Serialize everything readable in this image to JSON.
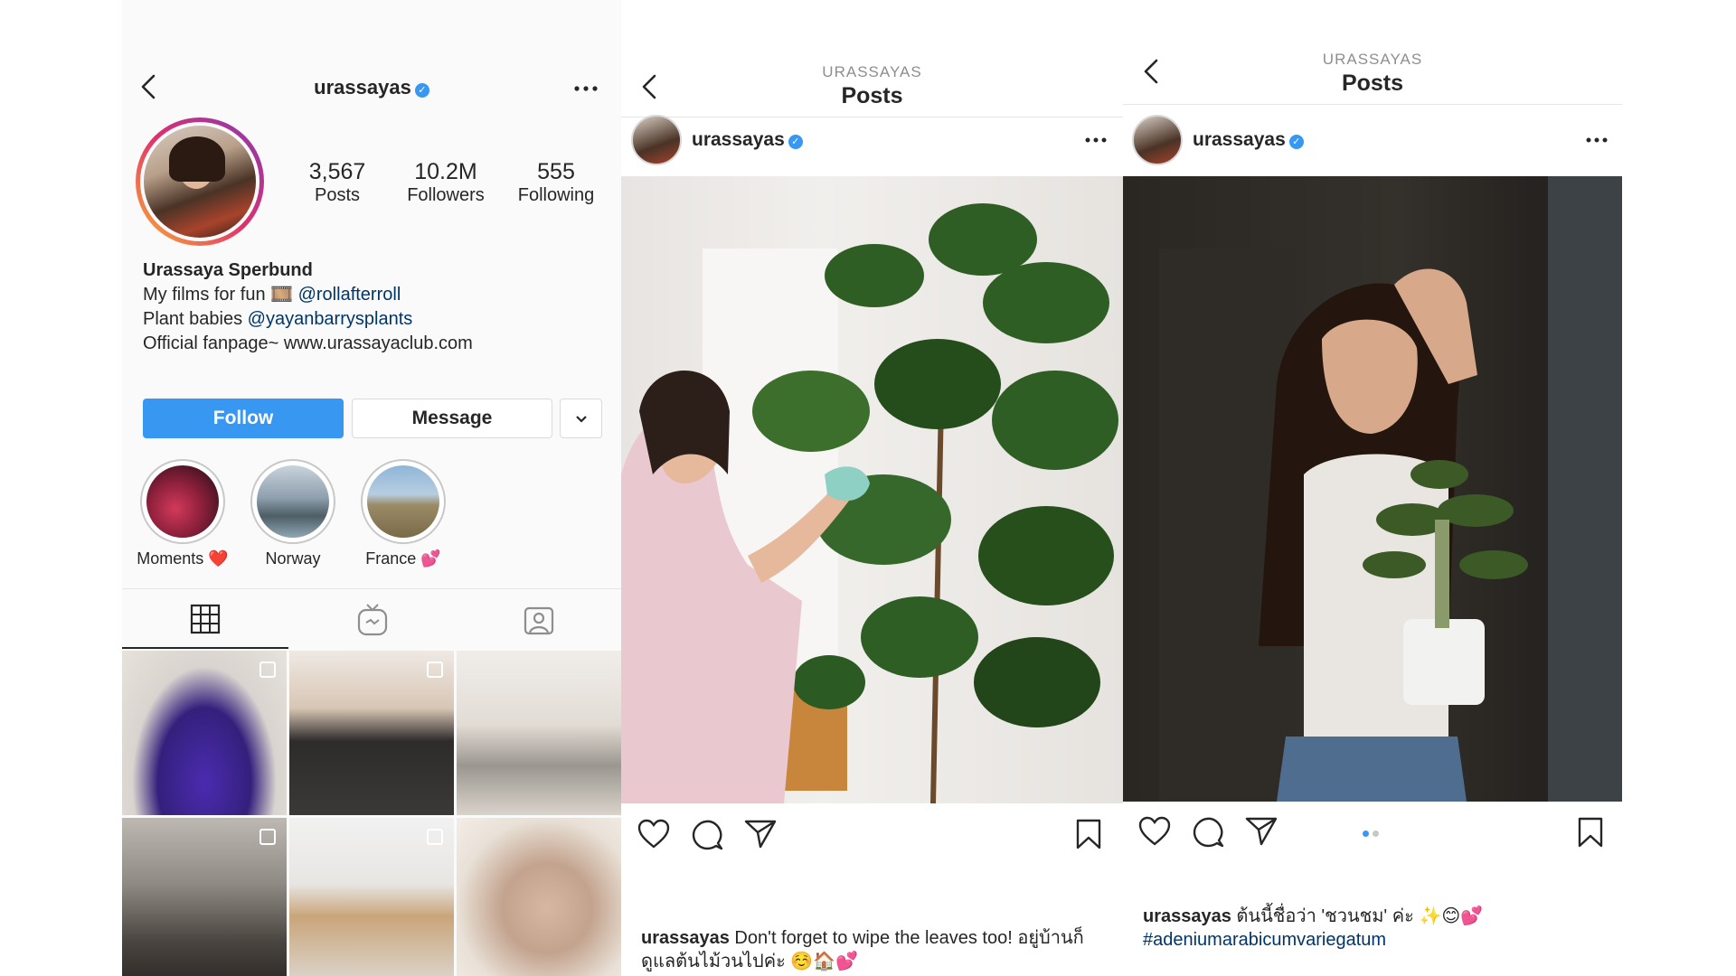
{
  "profile": {
    "username": "urassayas",
    "stats": [
      {
        "value": "3,567",
        "label": "Posts"
      },
      {
        "value": "10.2M",
        "label": "Followers"
      },
      {
        "value": "555",
        "label": "Following"
      }
    ],
    "name": "Urassaya Sperbund",
    "bio_line1_text": "My films for fun 🎞️ ",
    "bio_line1_link": "@rollafterroll",
    "bio_line2_text": "Plant babies ",
    "bio_line2_link": "@yayanbarrysplants",
    "bio_line3": "Official fanpage~ www.urassayaclub.com",
    "follow_label": "Follow",
    "message_label": "Message",
    "highlights": [
      {
        "label": "Moments ❤️"
      },
      {
        "label": "Norway"
      },
      {
        "label": "France 💕"
      }
    ],
    "tabs": [
      {
        "icon": "grid-icon"
      },
      {
        "icon": "igtv-icon"
      },
      {
        "icon": "tagged-icon"
      }
    ]
  },
  "post1": {
    "header_sub": "URASSAYAS",
    "header_title": "Posts",
    "username": "urassayas",
    "caption_user": "urassayas",
    "caption_text": " Don't forget to wipe the leaves too! อยู่บ้านก็ดูแลต้นไม้วนไปค่ะ ☺️🏠💕"
  },
  "post2": {
    "header_sub": "URASSAYAS",
    "header_title": "Posts",
    "username": "urassayas",
    "caption_user": "urassayas",
    "caption_text": " ต้นนี้ชื่อว่า 'ชวนชม' ค่ะ ✨😊💕",
    "hashtag": "#adeniumarabicumvariegatum",
    "carousel_pages": 2,
    "carousel_active": 1
  },
  "colors": {
    "follow_blue": "#3897f0",
    "link": "#003569",
    "verified": "#3897f0"
  }
}
